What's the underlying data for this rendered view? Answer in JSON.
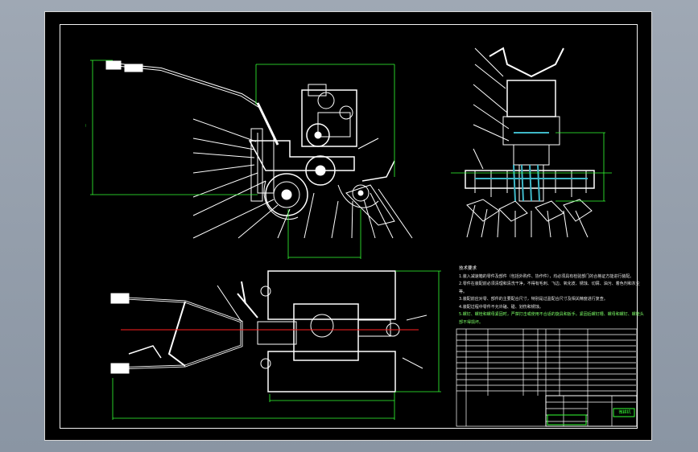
{
  "colors": {
    "background": "#8e99a6",
    "sheet": "#000000",
    "lines": "#ffffff",
    "dimension": "#33ff33",
    "centerline": "#ff2020",
    "hatch": "#3fb8c8"
  },
  "icons": {
    "drawing": "cad-drawing",
    "title_block": "title-block-table"
  },
  "tech_notes": {
    "title": "技术要求",
    "lines": [
      "1.装入减速箱的零件及部件（包括外购件、协作件），均必须具有检验部门的合格证方能进行装配。",
      "2.零件在装配前必须清理和清洗干净，不得有毛刺、飞边、氧化皮、锈蚀、切屑、油污、着色剂和灰尘等。",
      "3.装配前应对零、部件的主要配合尺寸，特别是过盈配合尺寸及相关精度进行复查。",
      "4.装配过程中零件不允许磕、碰、划伤和锈蚀。",
      "5.螺钉、螺栓和螺母紧固时，严禁打击或使用不合适的旋具和扳手。紧固后螺钉槽、螺母和螺钉、螺栓头部不得损坏。"
    ]
  },
  "title_block": {
    "drawing_name": "微耕机"
  }
}
